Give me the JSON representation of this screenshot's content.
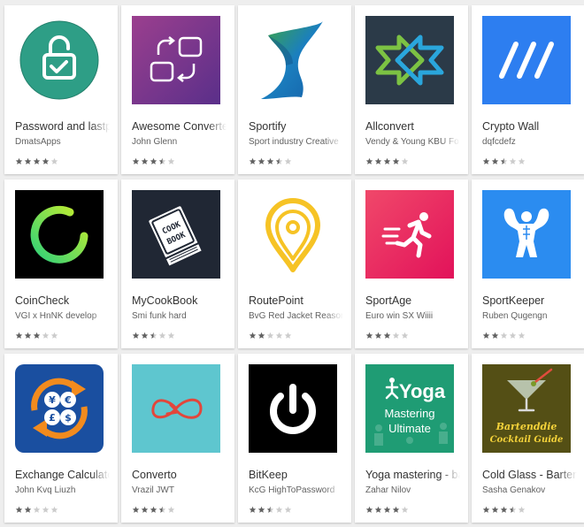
{
  "colors": {
    "star_filled": "#616161",
    "star_empty": "#cccccc",
    "card_bg": "#ffffff",
    "page_bg": "#eeeeee"
  },
  "apps": [
    {
      "title": "Password and lastpass",
      "developer": "DmatsApps",
      "rating": 4,
      "icon": "padlock-check-icon"
    },
    {
      "title": "Awesome Converter",
      "developer": "John Glenn",
      "rating": 3.5,
      "icon": "convert-boxes-icon"
    },
    {
      "title": "Sportify",
      "developer": "Sport industry Creative",
      "rating": 3.5,
      "icon": "s-ribbon-icon"
    },
    {
      "title": "Allconvert",
      "developer": "Vendy & Young KBU Fo",
      "rating": 4,
      "icon": "double-arrows-icon"
    },
    {
      "title": "Crypto Wall",
      "developer": "dqfcdefz",
      "rating": 2.5,
      "icon": "triple-slash-icon"
    },
    {
      "title": "CoinCheck",
      "developer": "VGI x HnNK develop",
      "rating": 3,
      "icon": "green-ring-icon"
    },
    {
      "title": "MyCookBook",
      "developer": "Smi funk hard",
      "rating": 2.5,
      "icon": "cook-book-icon"
    },
    {
      "title": "RoutePoint",
      "developer": "BvG Red Jacket Reasor",
      "rating": 2,
      "icon": "map-pin-icon"
    },
    {
      "title": "SportAge",
      "developer": "Euro win SX Wiiii",
      "rating": 3,
      "icon": "runner-icon"
    },
    {
      "title": "SportKeeper",
      "developer": "Ruben Qugengn",
      "rating": 2,
      "icon": "bodybuilder-icon"
    },
    {
      "title": "Exchange Calculator",
      "developer": "John Kvq Liuzh",
      "rating": 2,
      "icon": "currency-exchange-icon"
    },
    {
      "title": "Converto",
      "developer": "Vrazil JWT",
      "rating": 3.5,
      "icon": "infinity-arrow-icon"
    },
    {
      "title": "BitKeep",
      "developer": "KcG HighToPassword",
      "rating": 2.5,
      "icon": "power-button-icon"
    },
    {
      "title": "Yoga mastering - basic",
      "developer": "Zahar Nilov",
      "rating": 4,
      "icon": "yoga-icon",
      "icon_text": {
        "brand": "Yoga",
        "line1": "Mastering",
        "line2": "Ultimate"
      }
    },
    {
      "title": "Cold Glass - Bartender",
      "developer": "Sasha Genakov",
      "rating": 3.5,
      "icon": "cocktail-glass-icon",
      "icon_text": {
        "line1": "Bartenddie",
        "line2": "Cocktail Guide"
      }
    }
  ]
}
